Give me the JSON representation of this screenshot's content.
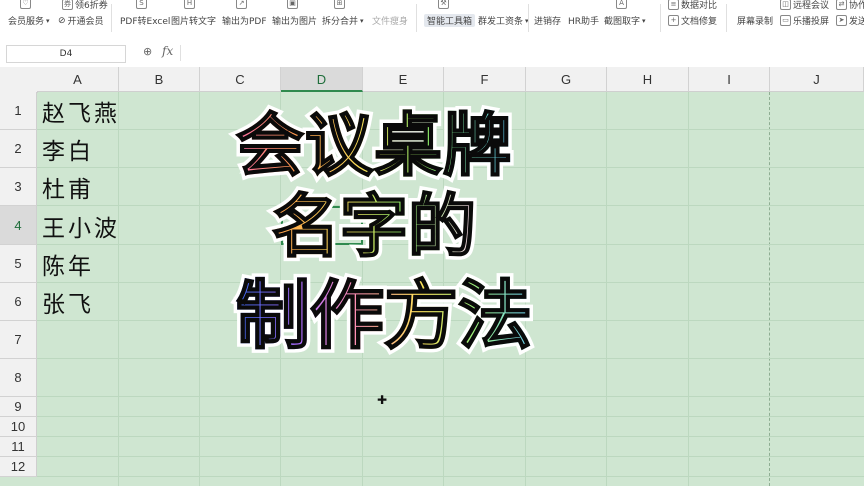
{
  "toolbar": {
    "row1": [
      {
        "label": "",
        "icon": "heart-icon"
      },
      {
        "label": "领6折券",
        "icon": "ticket-icon"
      },
      {
        "label": "",
        "icon": "pdf-excel-icon"
      },
      {
        "label": "",
        "icon": "image-text-icon"
      },
      {
        "label": "",
        "icon": "export-pdf-icon"
      }
    ],
    "member_service": "会员服务",
    "open_member": "开通会员",
    "pdf_to_excel": "PDF转Excel",
    "image_to_text": "图片转文字",
    "export_pdf": "输出为PDF",
    "export_image": "输出为图片",
    "split_merge": "拆分合并",
    "file_slim": "文件瘦身",
    "smart_toolbox": "智能工具箱",
    "bulk_payroll": "群发工资条",
    "invoicing": "进销存",
    "hr_assistant": "HR助手",
    "screenshot_ocr": "截图取字",
    "data_compare": "数据对比",
    "doc_repair": "文档修复",
    "screen_record": "屏幕录制",
    "remote_meeting": "远程会议",
    "share_screen": "乐播投屏",
    "coauthor": "协作",
    "send": "发送"
  },
  "formula_bar": {
    "name_box": "D4",
    "fx": "fx",
    "value": ""
  },
  "columns": [
    "A",
    "B",
    "C",
    "D",
    "E",
    "F",
    "G",
    "H",
    "I",
    "J"
  ],
  "selected_column": "D",
  "rows": [
    "1",
    "2",
    "3",
    "4",
    "5",
    "6",
    "7",
    "8",
    "9",
    "10",
    "11",
    "12"
  ],
  "selected_row": "4",
  "cells_a": [
    "赵飞燕",
    "李白",
    "杜甫",
    "王小波",
    "陈年",
    "张飞"
  ],
  "overlay": {
    "line1": "会议桌牌",
    "line2": "名字的",
    "line3": "制作方法"
  }
}
